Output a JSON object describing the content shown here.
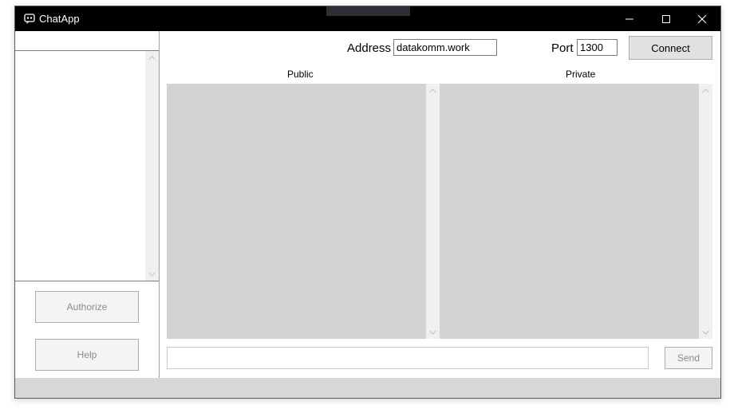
{
  "window": {
    "title": "ChatApp"
  },
  "connection": {
    "address_label": "Address",
    "address_value": "datakomm.work",
    "port_label": "Port",
    "port_value": "1300",
    "connect_label": "Connect"
  },
  "chat": {
    "public_label": "Public",
    "private_label": "Private",
    "message_value": "",
    "send_label": "Send"
  },
  "sidebar": {
    "top_field_value": "",
    "authorize_label": "Authorize",
    "help_label": "Help"
  },
  "colors": {
    "titlebar": "#000000",
    "chat_background": "#d3d3d3",
    "statusbar": "#d7d7d7"
  }
}
